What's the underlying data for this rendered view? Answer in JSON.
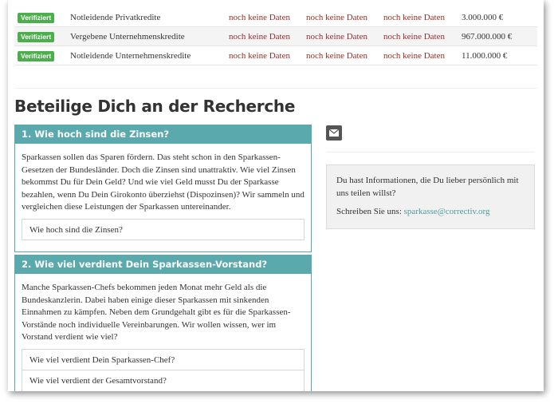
{
  "table": {
    "rows": [
      {
        "badge": "Verifiziert",
        "name": "Notleidende Privatkredite",
        "col1": "noch keine Daten",
        "col2": "noch keine Daten",
        "col3": "noch keine Daten",
        "amount": "3.000.000 €"
      },
      {
        "badge": "Verifiziert",
        "name": "Vergebene Unternehmenskredite",
        "col1": "noch keine Daten",
        "col2": "noch keine Daten",
        "col3": "noch keine Daten",
        "amount": "967.000.000 €"
      },
      {
        "badge": "Verifiziert",
        "name": "Notleidende Unternehmenskredite",
        "col1": "noch keine Daten",
        "col2": "noch keine Daten",
        "col3": "noch keine Daten",
        "amount": "11.000.000 €"
      }
    ]
  },
  "section": {
    "title": "Beteilige Dich an der Recherche"
  },
  "questions": [
    {
      "title": "1. Wie hoch sind die Zinsen?",
      "text": "Sparkassen sollen das Sparen fördern. Das steht schon in den Sparkassen-Gesetzen der Bundesländer. Doch die Zinsen sind unattraktiv. Wie viel Zinsen bekommst Du für Dein Geld? Und wie viel Geld musst Du der Sparkasse bezahlen, wenn Du Dein Girokonto überziehst (Dispozinsen)? Wir sammeln und vergleichen diese Leistungen der Sparkassen untereinander.",
      "answers": [
        "Wie hoch sind die Zinsen?"
      ]
    },
    {
      "title": "2. Wie viel verdient Dein Sparkassen-Vorstand?",
      "text": "Manche Sparkassen-Chefs bekommen jeden Monat mehr Geld als die Bundeskanzlerin. Dabei haben einige dieser Sparkassen mit sinkenden Einnahmen zu kämpfen. Neben dem Grundgehalt gibt es für die Sparkassen-Vorstände noch individuelle Vereinbarungen. Wir wollen wissen, wer im Vorstand verdient wie viel?",
      "answers": [
        "Wie viel verdient Dein Sparkassen-Chef?",
        "Wie viel verdient der Gesamtvorstand?"
      ]
    }
  ],
  "sidebar": {
    "mail_icon": "envelope-icon",
    "info_text": "Du hast Informationen, die Du lieber persönlich mit uns teilen willst?",
    "contact_prefix": "Schreiben Sie uns: ",
    "contact_email": "sparkasse@correctiv.org"
  },
  "colors": {
    "accent": "#5aa9ad",
    "badge": "#4cae4c",
    "no_data": "#9b2c2c",
    "link": "#4f9aa0"
  }
}
